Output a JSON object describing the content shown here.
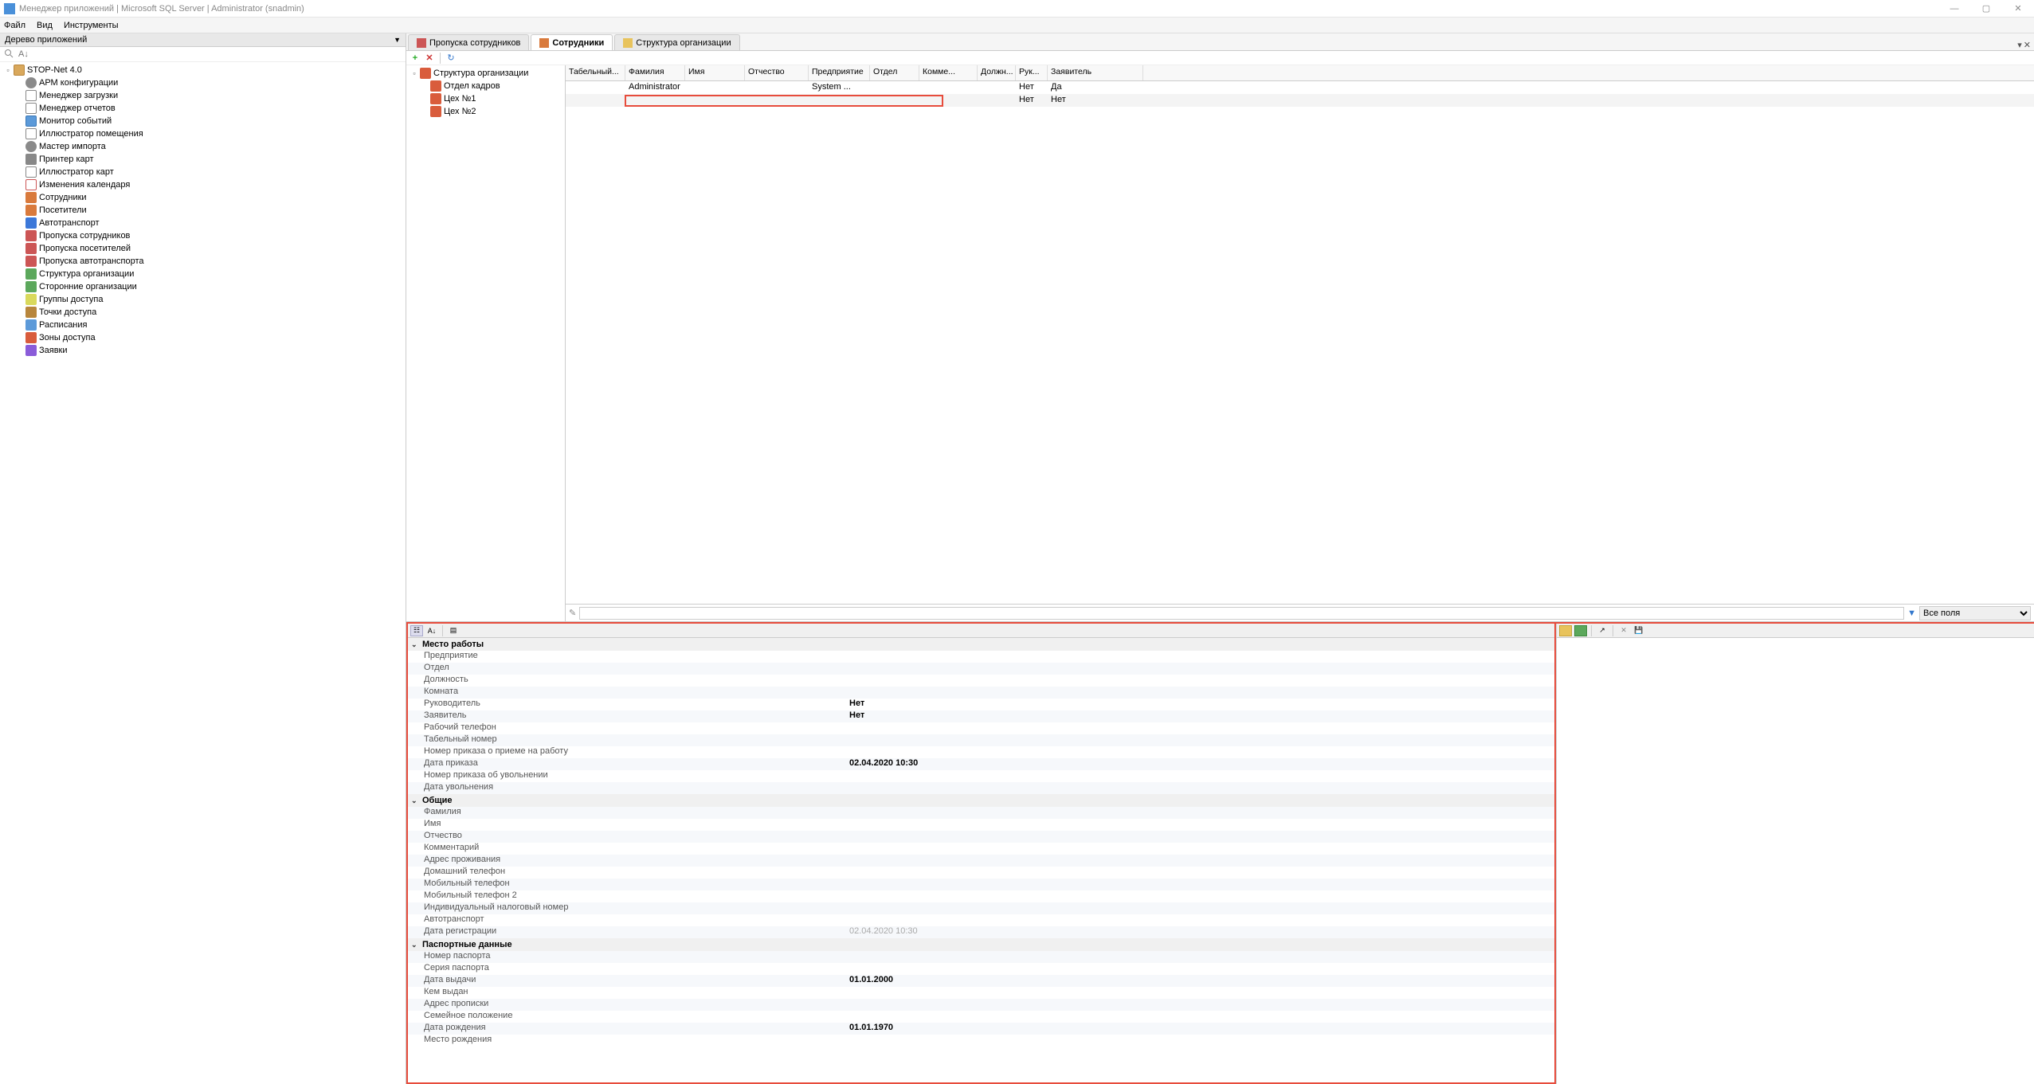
{
  "title": "Менеджер приложений | Microsoft SQL Server | Administrator  (snadmin)",
  "menu": {
    "file": "Файл",
    "view": "Вид",
    "tools": "Инструменты"
  },
  "sidebar_header": "Дерево приложений",
  "search_placeholder": "A↓",
  "tree_root": "STOP-Net 4.0",
  "tree_items": [
    "АРМ конфигурации",
    "Менеджер загрузки",
    "Менеджер отчетов",
    "Монитор событий",
    "Иллюстратор помещения",
    "Мастер импорта",
    "Принтер карт",
    "Иллюстратор карт",
    "Изменения календаря",
    "Сотрудники",
    "Посетители",
    "Автотранспорт",
    "Пропуска сотрудников",
    "Пропуска посетителей",
    "Пропуска автотранспорта",
    "Структура организации",
    "Сторонние организации",
    "Группы доступа",
    "Точки доступа",
    "Расписания",
    "Зоны доступа",
    "Заявки"
  ],
  "tabs": [
    {
      "label": "Пропуска сотрудников",
      "active": false
    },
    {
      "label": "Сотрудники",
      "active": true
    },
    {
      "label": "Структура организации",
      "active": false
    }
  ],
  "subtree": {
    "root": "Структура организации",
    "items": [
      "Отдел кадров",
      "Цех №1",
      "Цех №2"
    ]
  },
  "grid": {
    "headers": [
      "Табельный...",
      "Фамилия",
      "Имя",
      "Отчество",
      "Предприятие",
      "Отдел",
      "Комме...",
      "Должн...",
      "Рук...",
      "Заявитель"
    ],
    "rows": [
      {
        "cells": [
          "",
          "Administrator",
          "",
          "",
          "System ...",
          "",
          "",
          "",
          "Нет",
          "Да"
        ]
      },
      {
        "cells": [
          "",
          "",
          "",
          "",
          "",
          "",
          "",
          "",
          "Нет",
          "Нет"
        ]
      }
    ]
  },
  "filter": {
    "label": "Все поля"
  },
  "props": {
    "cat1": "Место работы",
    "cat1_items": [
      {
        "l": "Предприятие",
        "v": ""
      },
      {
        "l": "Отдел",
        "v": ""
      },
      {
        "l": "Должность",
        "v": ""
      },
      {
        "l": "Комната",
        "v": ""
      },
      {
        "l": "Руководитель",
        "v": "Нет",
        "b": true
      },
      {
        "l": "Заявитель",
        "v": "Нет",
        "b": true
      },
      {
        "l": "Рабочий телефон",
        "v": ""
      },
      {
        "l": "Табельный номер",
        "v": ""
      },
      {
        "l": "Номер приказа о приеме на работу",
        "v": ""
      },
      {
        "l": "Дата приказа",
        "v": "02.04.2020 10:30",
        "b": true
      },
      {
        "l": "Номер приказа об увольнении",
        "v": ""
      },
      {
        "l": "Дата увольнения",
        "v": ""
      }
    ],
    "cat2": "Общие",
    "cat2_items": [
      {
        "l": "Фамилия",
        "v": ""
      },
      {
        "l": "Имя",
        "v": ""
      },
      {
        "l": "Отчество",
        "v": ""
      },
      {
        "l": "Комментарий",
        "v": ""
      },
      {
        "l": "Адрес проживания",
        "v": ""
      },
      {
        "l": "Домашний телефон",
        "v": ""
      },
      {
        "l": "Мобильный телефон",
        "v": ""
      },
      {
        "l": "Мобильный телефон 2",
        "v": ""
      },
      {
        "l": "Индивидуальный налоговый номер",
        "v": ""
      },
      {
        "l": "Автотранспорт",
        "v": ""
      },
      {
        "l": "Дата регистрации",
        "v": "02.04.2020 10:30",
        "d": true
      }
    ],
    "cat3": "Паспортные данные",
    "cat3_items": [
      {
        "l": "Номер паспорта",
        "v": ""
      },
      {
        "l": "Серия паспорта",
        "v": ""
      },
      {
        "l": "Дата выдачи",
        "v": "01.01.2000",
        "b": true
      },
      {
        "l": "Кем выдан",
        "v": ""
      },
      {
        "l": "Адрес прописки",
        "v": ""
      },
      {
        "l": "Семейное положение",
        "v": ""
      },
      {
        "l": "Дата рождения",
        "v": "01.01.1970",
        "b": true
      },
      {
        "l": "Место рождения",
        "v": ""
      }
    ]
  }
}
